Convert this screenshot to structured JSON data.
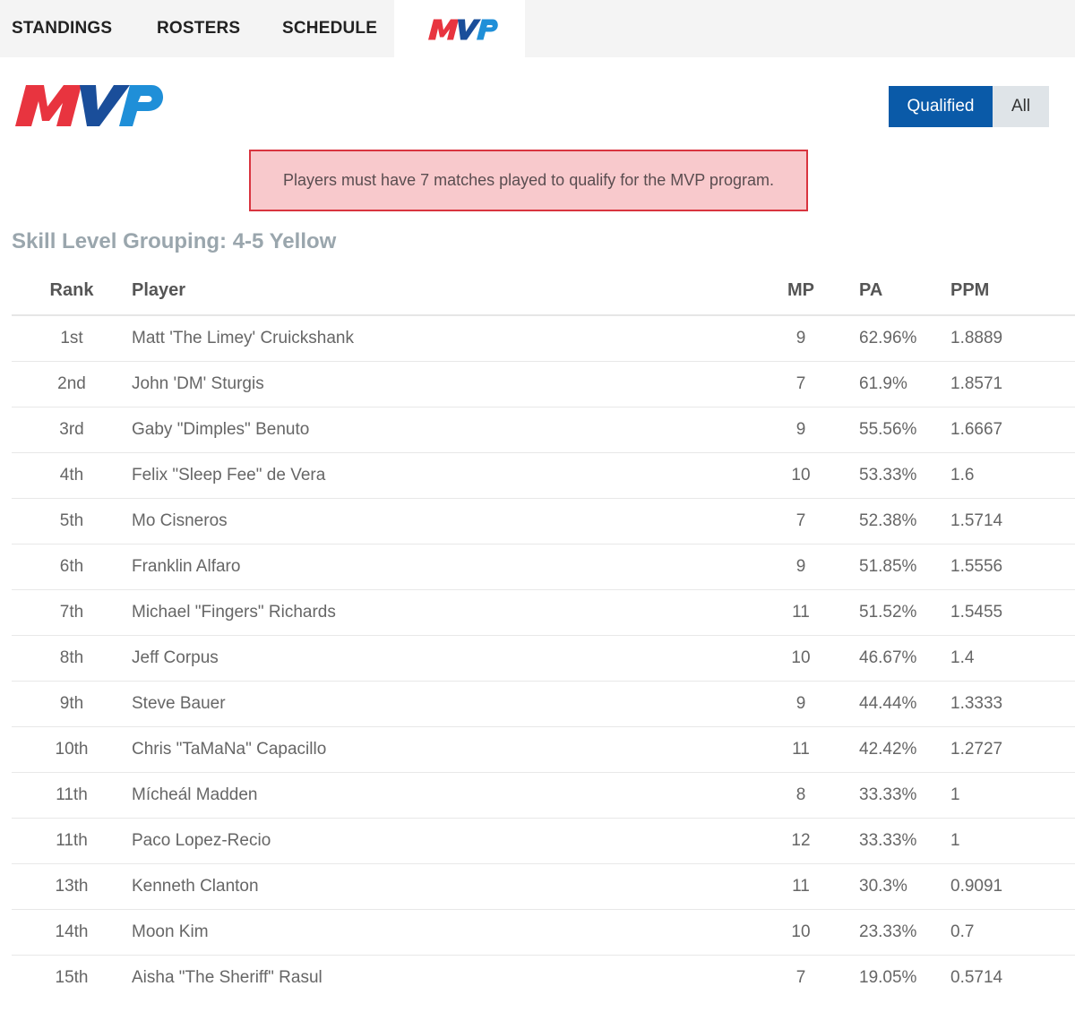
{
  "nav": {
    "items": [
      "STANDINGS",
      "ROSTERS",
      "SCHEDULE"
    ],
    "active": "MVP"
  },
  "logo": {
    "text": "MVP",
    "colors": {
      "red": "#e8343f",
      "blue": "#1f8fd8"
    }
  },
  "toggle": {
    "qualified": "Qualified",
    "all": "All",
    "selected": "Qualified"
  },
  "notice": "Players must have 7 matches played to qualify for the MVP program.",
  "group_title": "Skill Level Grouping: 4-5 Yellow",
  "table": {
    "headers": {
      "rank": "Rank",
      "player": "Player",
      "mp": "MP",
      "pa": "PA",
      "ppm": "PPM"
    },
    "rows": [
      {
        "rank": "1st",
        "player": "Matt 'The Limey' Cruickshank",
        "mp": "9",
        "pa": "62.96%",
        "ppm": "1.8889"
      },
      {
        "rank": "2nd",
        "player": "John 'DM' Sturgis",
        "mp": "7",
        "pa": "61.9%",
        "ppm": "1.8571"
      },
      {
        "rank": "3rd",
        "player": "Gaby \"Dimples\" Benuto",
        "mp": "9",
        "pa": "55.56%",
        "ppm": "1.6667"
      },
      {
        "rank": "4th",
        "player": "Felix \"Sleep Fee\" de Vera",
        "mp": "10",
        "pa": "53.33%",
        "ppm": "1.6"
      },
      {
        "rank": "5th",
        "player": "Mo Cisneros",
        "mp": "7",
        "pa": "52.38%",
        "ppm": "1.5714"
      },
      {
        "rank": "6th",
        "player": "Franklin Alfaro",
        "mp": "9",
        "pa": "51.85%",
        "ppm": "1.5556"
      },
      {
        "rank": "7th",
        "player": "Michael \"Fingers\" Richards",
        "mp": "11",
        "pa": "51.52%",
        "ppm": "1.5455"
      },
      {
        "rank": "8th",
        "player": "Jeff Corpus",
        "mp": "10",
        "pa": "46.67%",
        "ppm": "1.4"
      },
      {
        "rank": "9th",
        "player": "Steve Bauer",
        "mp": "9",
        "pa": "44.44%",
        "ppm": "1.3333"
      },
      {
        "rank": "10th",
        "player": "Chris \"TaMaNa\" Capacillo",
        "mp": "11",
        "pa": "42.42%",
        "ppm": "1.2727"
      },
      {
        "rank": "11th",
        "player": "Mícheál Madden",
        "mp": "8",
        "pa": "33.33%",
        "ppm": "1"
      },
      {
        "rank": "11th",
        "player": "Paco Lopez-Recio",
        "mp": "12",
        "pa": "33.33%",
        "ppm": "1"
      },
      {
        "rank": "13th",
        "player": "Kenneth Clanton",
        "mp": "11",
        "pa": "30.3%",
        "ppm": "0.9091"
      },
      {
        "rank": "14th",
        "player": "Moon Kim",
        "mp": "10",
        "pa": "23.33%",
        "ppm": "0.7"
      },
      {
        "rank": "15th",
        "player": "Aisha \"The Sheriff\" Rasul",
        "mp": "7",
        "pa": "19.05%",
        "ppm": "0.5714"
      }
    ]
  }
}
